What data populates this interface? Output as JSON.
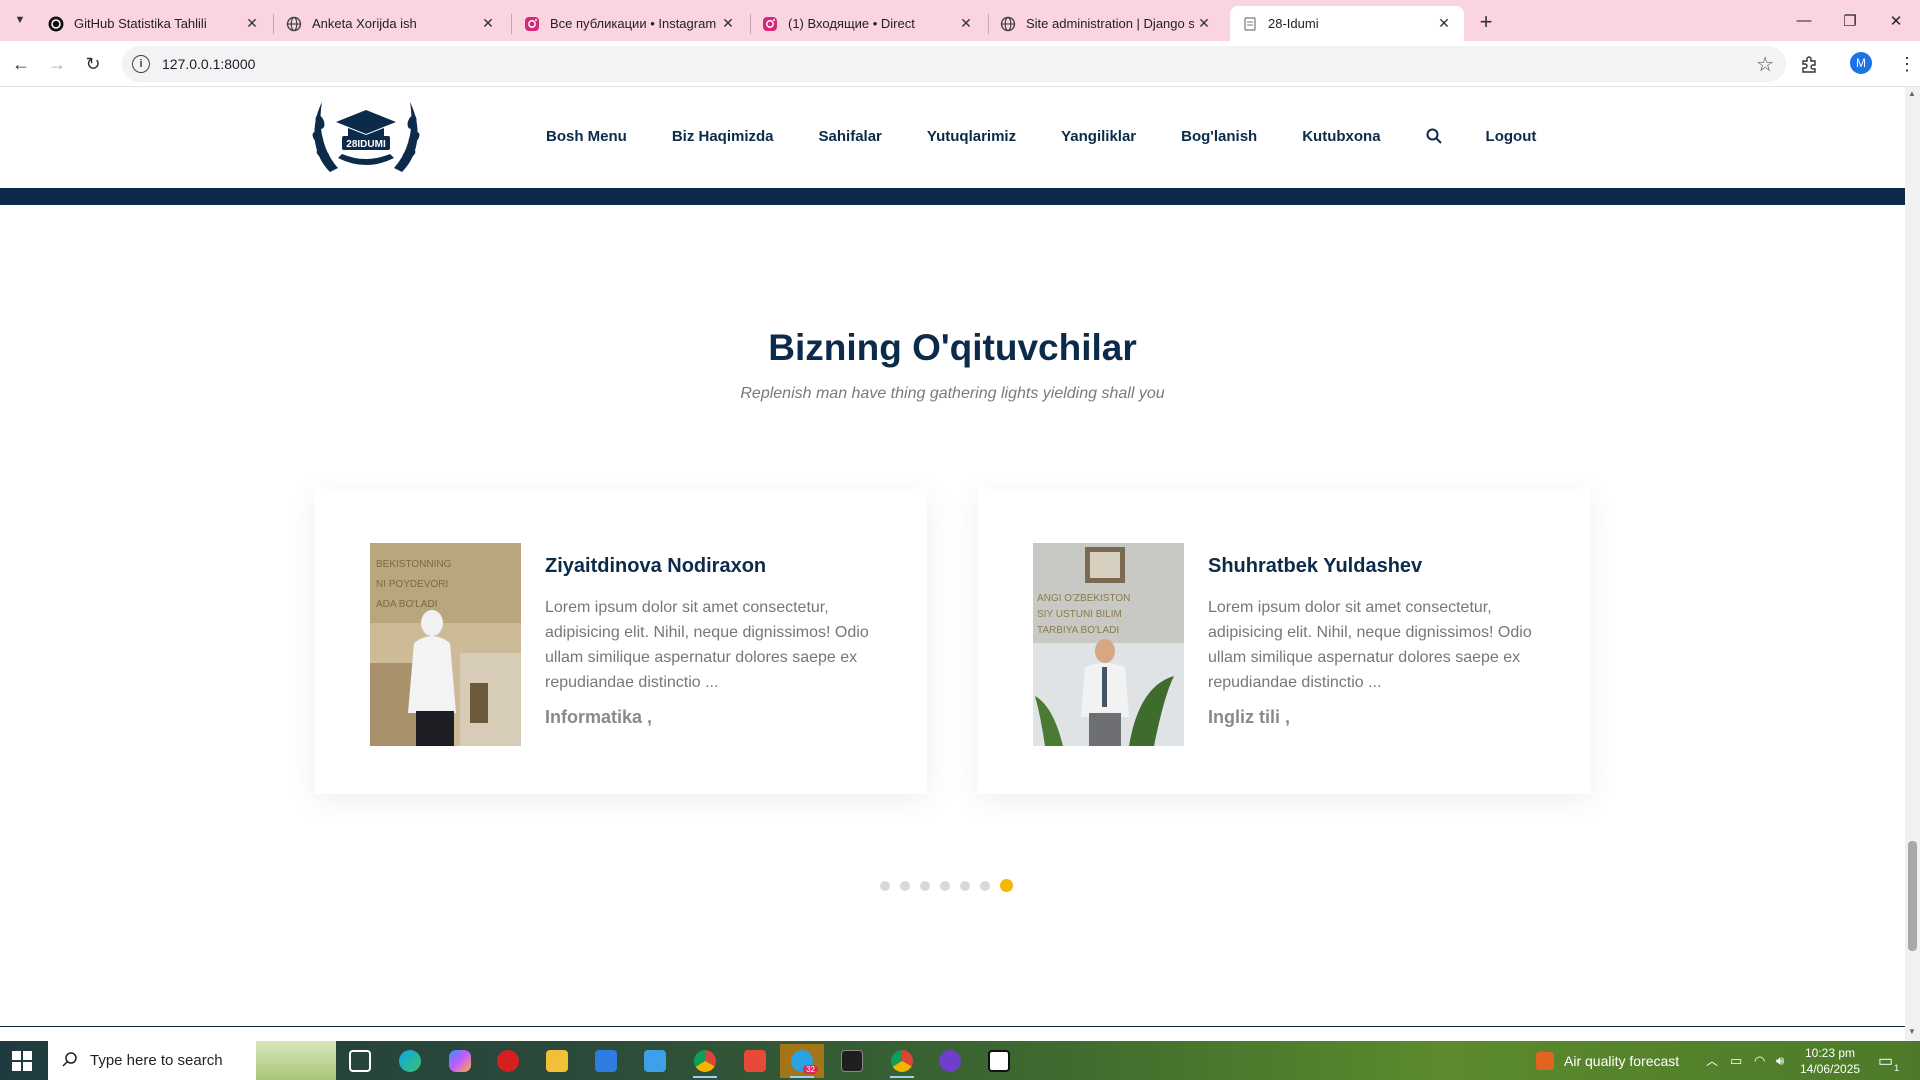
{
  "browser": {
    "tabs": [
      {
        "title": "GitHub Statistika Tahlili",
        "icon": "github-icon",
        "active": false
      },
      {
        "title": "Anketa Xorijda ish",
        "icon": "globe-icon",
        "active": false
      },
      {
        "title": "Все публикации • Instagram",
        "icon": "instagram-icon",
        "active": false
      },
      {
        "title": "(1) Входящие • Direct",
        "icon": "instagram-icon",
        "active": false
      },
      {
        "title": "Site administration | Django site admin",
        "icon": "globe-icon",
        "active": false
      },
      {
        "title": "28-Idumi",
        "icon": "page-icon",
        "active": true
      }
    ],
    "url": "127.0.0.1:8000",
    "profile_initial": "M"
  },
  "site": {
    "logo_text": "28IDUMI",
    "nav": [
      "Bosh Menu",
      "Biz Haqimizda",
      "Sahifalar",
      "Yutuqlarimiz",
      "Yangiliklar",
      "Bog'lanish",
      "Kutubxona"
    ],
    "logout": "Logout"
  },
  "section": {
    "title": "Bizning O'qituvchilar",
    "subtitle": "Replenish man have thing gathering lights yielding shall you"
  },
  "teachers": [
    {
      "name": "Ziyaitdinova Nodiraxon",
      "description": "Lorem ipsum dolor sit amet consectetur, adipisicing elit. Nihil, neque dignissimos! Odio ullam similique aspernatur dolores saepe ex repudiandae distinctio ...",
      "subject": "Informatika ,"
    },
    {
      "name": "Shuhratbek Yuldashev",
      "description": "Lorem ipsum dolor sit amet consectetur, adipisicing elit. Nihil, neque dignissimos! Odio ullam similique aspernatur dolores saepe ex repudiandae distinctio ...",
      "subject": "Ingliz tili ,"
    }
  ],
  "carousel": {
    "total": 7,
    "active_index": 6
  },
  "taskbar": {
    "search_placeholder": "Type here to search",
    "weather": "Air quality forecast",
    "time": "10:23 pm",
    "date": "14/06/2025",
    "notification_count": "1",
    "telegram_badge": "32"
  },
  "colors": {
    "navy": "#0c2b4b",
    "tab_strip": "#fad5e0",
    "accent_dot": "#f5b800"
  }
}
